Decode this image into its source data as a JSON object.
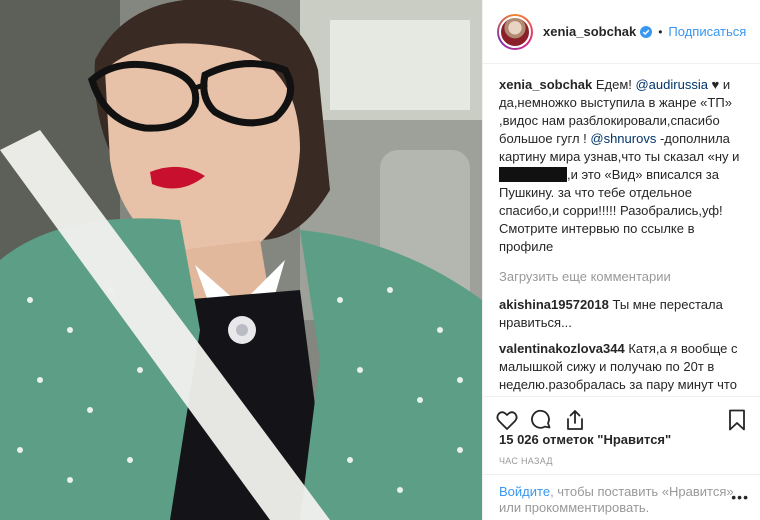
{
  "header": {
    "username": "xenia_sobchak",
    "separator": "•",
    "follow_label": "Подписаться"
  },
  "caption": {
    "username": "xenia_sobchak",
    "t1": " Едем! ",
    "m1": "@audirussia",
    "t2": " ♥ и да,немножко выступила в жанре «ТП» ,видос нам разблокировали,спасибо большое гугл ! ",
    "m2": "@shnurovs",
    "t3": " -дополнила картину мира узнав,что ты сказал «ну и ",
    "t4": ",и это «Вид» вписался за Пушкину. за что тебе отдельное спасибо,и сорри!!!!! Разобрались,уф! Смотрите интервью по ссылке в профиле"
  },
  "load_more": "Загрузить еще комментарии",
  "comments": [
    {
      "username": "akishina19572018",
      "text": " Ты мне перестала нравиться..."
    },
    {
      "username": "valentinakozlova344",
      "text": " Катя,а я вообще с малышкой сижу и получаю по 20т в неделю.разобралась за пару минут что да как.да там можно даже со смартфона, главное чтоб в наличии были.там в принципе ничего сверхсложного нету..если тоже есть желаете, загляните"
    }
  ],
  "likes_text": "15 026 отметок \"Нравится\"",
  "time_ago": "ЧАС НАЗАД",
  "footer": {
    "login_label": "Войдите",
    "text1": ", чтобы поставить «Нравится»",
    "text2": "или прокомментировать.",
    "more_label": "•••"
  },
  "icons": {
    "like": "heart-icon",
    "comment": "comment-icon",
    "share": "share-icon",
    "save": "bookmark-icon",
    "verified": "verified-badge-icon"
  },
  "colors": {
    "link": "#3897f0",
    "mention": "#003569",
    "muted": "#999999",
    "text": "#262626"
  }
}
